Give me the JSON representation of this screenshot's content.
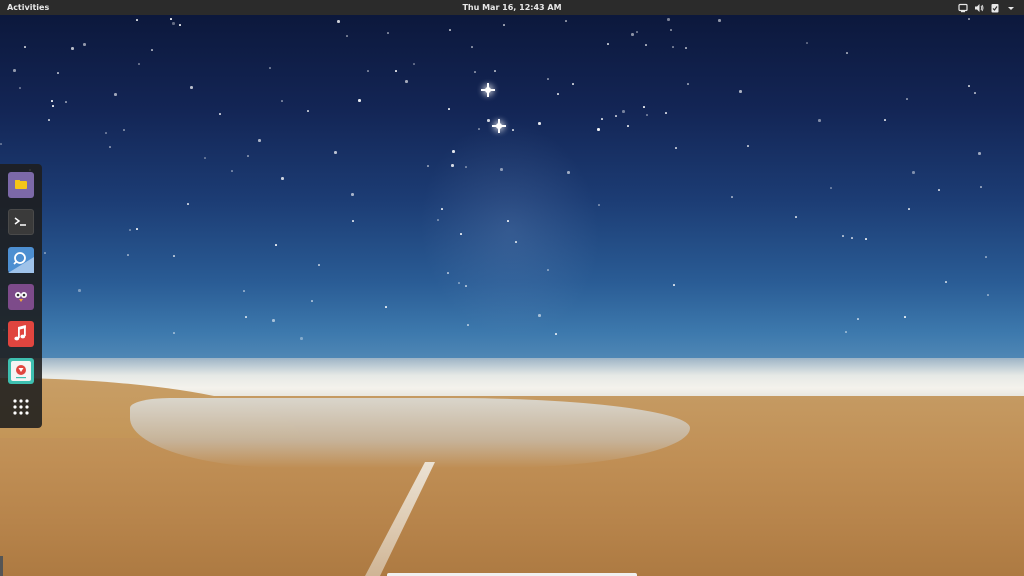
{
  "topbar": {
    "activities_label": "Activities",
    "clock_text": "Thu Mar 16, 12:43 AM",
    "tray_icons": [
      "display-icon",
      "volume-icon",
      "clipboard-check-icon",
      "system-menu-arrow-icon"
    ]
  },
  "dock": {
    "items": [
      {
        "name": "files-icon",
        "color": "#7c69a8"
      },
      {
        "name": "terminal-icon",
        "color": "#4a4a4a"
      },
      {
        "name": "web-browser-icon",
        "color": "#4d8fd1"
      },
      {
        "name": "chat-app-icon",
        "color": "#7d4b8a"
      },
      {
        "name": "music-icon",
        "color": "#e0453f"
      },
      {
        "name": "software-center-icon",
        "color": "#3ebfb0"
      },
      {
        "name": "show-applications-icon",
        "color": "#ffffff"
      }
    ]
  },
  "colors": {
    "topbar_bg": "#2b2b2b",
    "dock_bg": "#1e1e1e",
    "sky_top": "#0b1638",
    "sky_horizon": "#5289b6",
    "sand": "#c08f55"
  }
}
